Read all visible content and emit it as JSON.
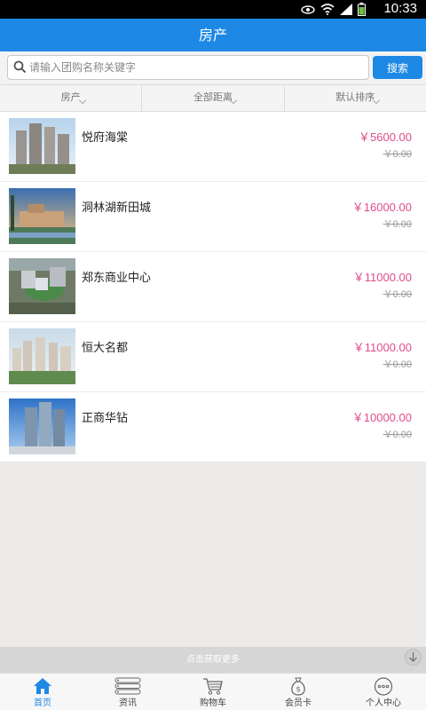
{
  "status_bar": {
    "time": "10:33"
  },
  "header": {
    "title": "房产"
  },
  "search": {
    "placeholder": "请输入团购名称关键字",
    "button_label": "搜索"
  },
  "filters": [
    {
      "label": "房产"
    },
    {
      "label": "全部距离"
    },
    {
      "label": "默认排序"
    }
  ],
  "listings": [
    {
      "name": "悦府海棠",
      "price": "￥5600.00",
      "original_price": "￥0.00"
    },
    {
      "name": "洞林湖新田城",
      "price": "￥16000.00",
      "original_price": "￥0.00"
    },
    {
      "name": "郑东商业中心",
      "price": "￥11000.00",
      "original_price": "￥0.00"
    },
    {
      "name": "恒大名都",
      "price": "￥11000.00",
      "original_price": "￥0.00"
    },
    {
      "name": "正商华钻",
      "price": "￥10000.00",
      "original_price": "￥0.00"
    }
  ],
  "load_more": {
    "label": "点击获取更多"
  },
  "tabs": [
    {
      "label": "首页",
      "icon": "home-icon",
      "active": true
    },
    {
      "label": "资讯",
      "icon": "list-icon"
    },
    {
      "label": "购物车",
      "icon": "cart-icon"
    },
    {
      "label": "会员卡",
      "icon": "money-bag-icon"
    },
    {
      "label": "个人中心",
      "icon": "chat-bubble-icon"
    }
  ],
  "colors": {
    "primary": "#1e88e5",
    "price": "#e04c8c",
    "background": "#ecebea"
  }
}
